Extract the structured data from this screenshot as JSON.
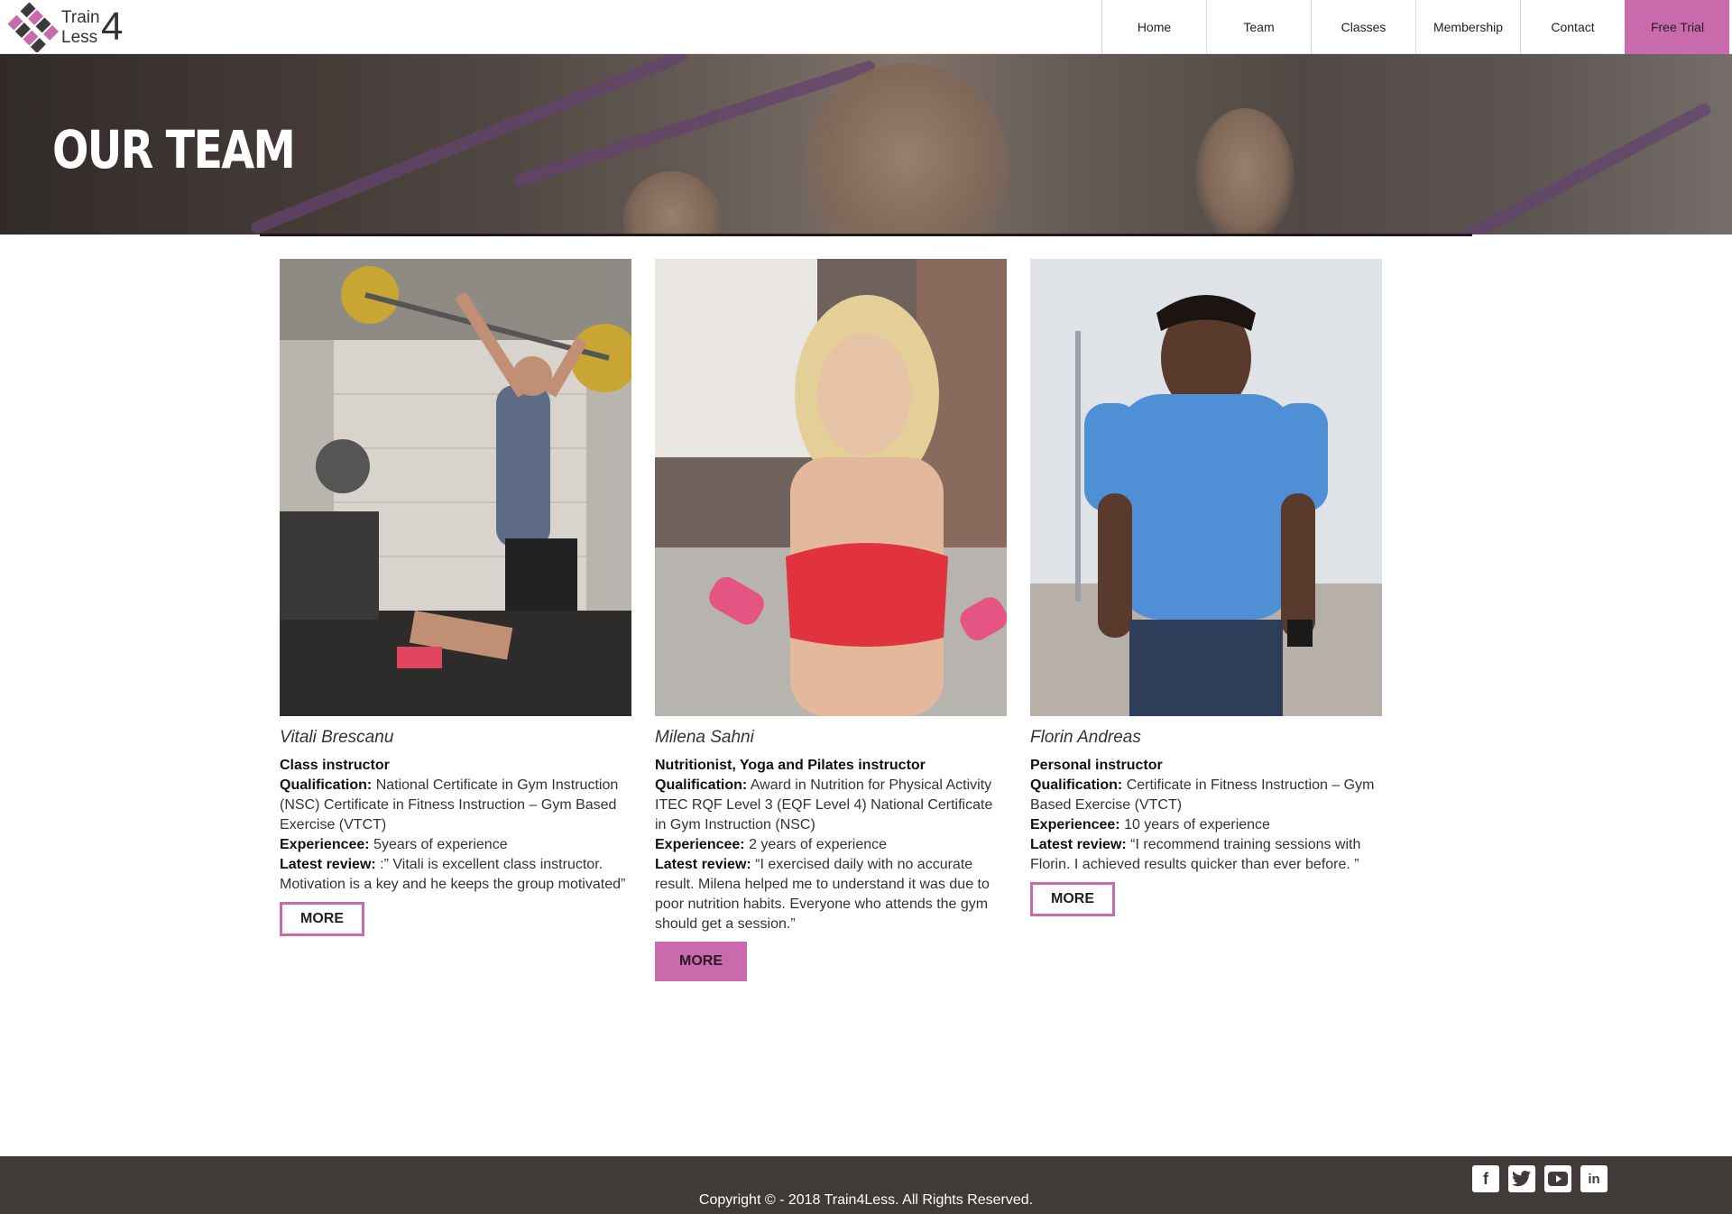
{
  "brand": {
    "line1": "Train",
    "line2": "Less",
    "number": "4"
  },
  "nav": {
    "home": "Home",
    "team": "Team",
    "classes": "Classes",
    "membership": "Membership",
    "contact": "Contact",
    "free_trial": "Free Trial"
  },
  "hero": {
    "title": "OUR TEAM"
  },
  "team": [
    {
      "name": "Vitali Brescanu",
      "role": "Class instructor",
      "qualification_label": "Qualification:",
      "qualification": "National Certificate in Gym Instruction (NSC) Certificate in Fitness Instruction – Gym Based Exercise (VTCT)",
      "experience_label": "Experiencee:",
      "experience": "5years of experience",
      "review_label": "Latest review:",
      "review": ":” Vitali is excellent class instructor. Motivation is a key and he keeps the group motivated”",
      "more": "MORE"
    },
    {
      "name": "Milena Sahni",
      "role": "Nutritionist, Yoga and Pilates instructor",
      "qualification_label": "Qualification:",
      "qualification": "Award in Nutrition for Physical Activity ITEC RQF Level 3 (EQF Level 4) National Certificate in Gym Instruction (NSC)",
      "experience_label": "Experiencee:",
      "experience": "2 years of experience",
      "review_label": "Latest review:",
      "review": "“I exercised daily with no accurate result. Milena helped me to understand it was due to poor nutrition habits. Everyone who attends the gym should get a session.”",
      "more": "MORE"
    },
    {
      "name": "Florin Andreas",
      "role": "Personal instructor",
      "qualification_label": "Qualification:",
      "qualification": "Certificate in Fitness Instruction – Gym Based Exercise (VTCT)",
      "experience_label": "Experiencee:",
      "experience": "10 years of experience",
      "review_label": "Latest review:",
      "review": "“I recommend training sessions with Florin. I achieved results quicker than ever before. ”",
      "more": "MORE"
    }
  ],
  "footer": {
    "copyright": "Copyright © - 2018 Train4Less. All Rights Reserved.",
    "social_icons": [
      "facebook-icon",
      "twitter-icon",
      "youtube-icon",
      "linkedin-icon"
    ]
  },
  "colors": {
    "accent": "#c86aac",
    "footer_bg": "#403a38",
    "hero_text": "#ffffff"
  }
}
